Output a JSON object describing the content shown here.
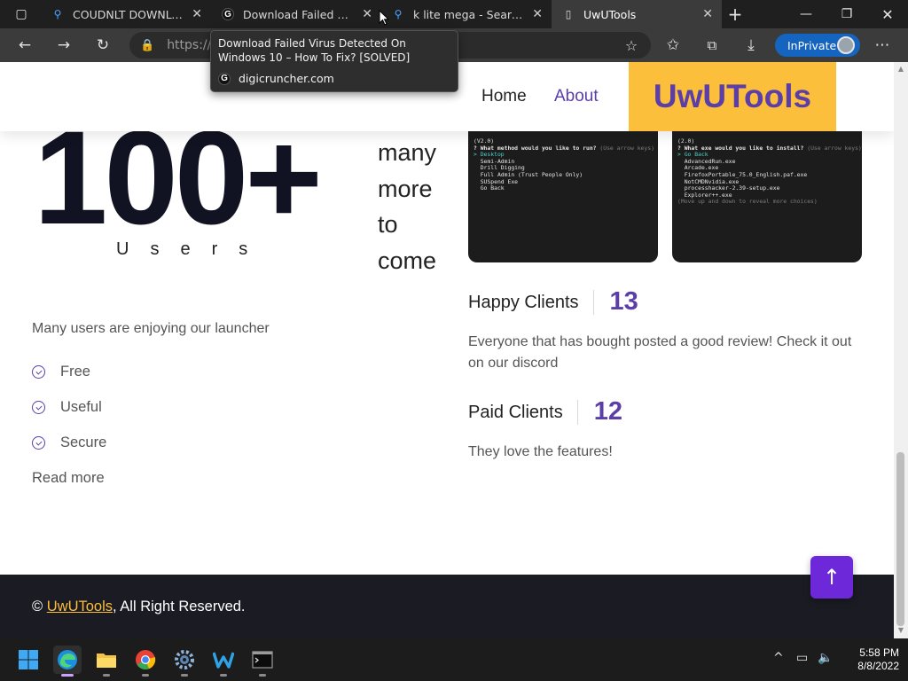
{
  "browser": {
    "tabs": [
      {
        "title": "COUDNLT DOWNLOAD",
        "icon": "search-icon"
      },
      {
        "title": "Download Failed Virus D",
        "icon": "g-favicon-icon"
      },
      {
        "title": "k lite mega - Search",
        "icon": "search-icon"
      },
      {
        "title": "UwUTools",
        "icon": "page-icon"
      }
    ],
    "address": "https://",
    "inprivate_label": "InPrivate",
    "tooltip": {
      "title": "Download Failed Virus Detected On Windows 10 – How To Fix? [SOLVED]",
      "domain": "digicruncher.com"
    }
  },
  "site": {
    "brand": "UwUTools",
    "nav": {
      "home": "Home",
      "about": "About"
    },
    "big_number": "100+",
    "big_label": "Users",
    "more_text": "many more to come",
    "intro": "Many users are enjoying our launcher",
    "features": [
      "Free",
      "Useful",
      "Secure"
    ],
    "read_more": "Read more",
    "terminal1": {
      "version": "(V2.0)",
      "prompt": "? What method would you like to run?",
      "hint": "(Use arrow keys)",
      "items": [
        "Desktop",
        "Semi-Admin",
        "Drill Digging",
        "Full Admin (Trust People Only)",
        "SUSpend Exe",
        "Go Back"
      ]
    },
    "terminal2": {
      "version": "(2.0)",
      "prompt": "? What exe would you like to install?",
      "hint": "(Use arrow keys)",
      "items": [
        "Go Back",
        "AdvancedRun.exe",
        "Arcade.exe",
        "FirefoxPortable_75.0_English.paf.exe",
        "NotCMDNvidia.exe",
        "processhacker-2.39-setup.exe",
        "Explorer++.exe"
      ],
      "footer": "(Move up and down to reveal more choices)"
    },
    "stats": [
      {
        "label": "Happy Clients",
        "value": "13",
        "desc": "Everyone that has bought posted a good review! Check it out on our discord"
      },
      {
        "label": "Paid Clients",
        "value": "12",
        "desc": "They love the features!"
      }
    ],
    "footer": {
      "prefix": "© ",
      "brand_link": "UwUTools",
      "suffix": ", All Right Reserved."
    }
  },
  "taskbar": {
    "apps": [
      "windows-start-icon",
      "edge-icon",
      "file-explorer-icon",
      "chrome-icon",
      "settings-icon",
      "wise-app-icon",
      "terminal-icon"
    ],
    "time": "5:58 PM",
    "date": "8/8/2022"
  },
  "colors": {
    "accent": "#5b3ea8",
    "brand_bg": "#fbbf3c",
    "footer_bg": "#1b1b24",
    "totop": "#6d28d9"
  }
}
